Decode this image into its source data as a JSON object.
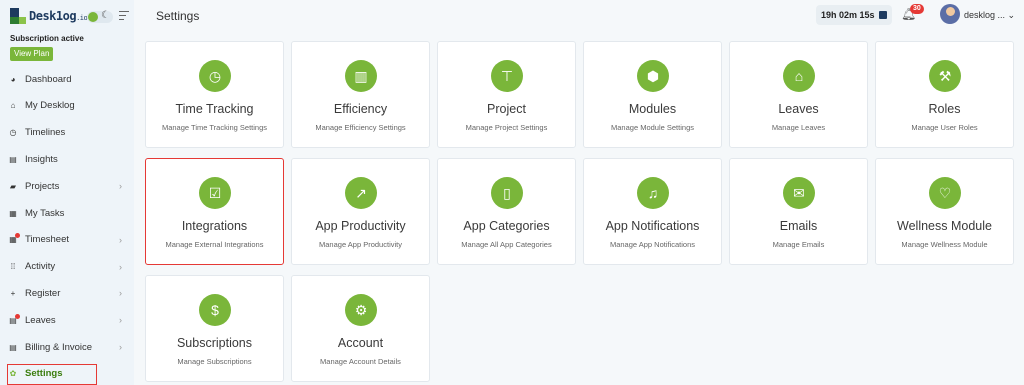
{
  "brand": {
    "name": "Desk1og",
    "suffix": ".io"
  },
  "subscription": {
    "status": "Subscription active",
    "view_plan": "View Plan"
  },
  "nav": [
    {
      "label": "Dashboard",
      "icon": "dashboard-icon",
      "glyph": "◕",
      "chevron": false,
      "dot": false
    },
    {
      "label": "My Desklog",
      "icon": "home-icon",
      "glyph": "⌂",
      "chevron": false,
      "dot": false
    },
    {
      "label": "Timelines",
      "icon": "clock-icon",
      "glyph": "◷",
      "chevron": false,
      "dot": false
    },
    {
      "label": "Insights",
      "icon": "book-icon",
      "glyph": "▤",
      "chevron": false,
      "dot": false
    },
    {
      "label": "Projects",
      "icon": "folder-icon",
      "glyph": "▰",
      "chevron": true,
      "dot": false
    },
    {
      "label": "My Tasks",
      "icon": "tasks-icon",
      "glyph": "▦",
      "chevron": false,
      "dot": false
    },
    {
      "label": "Timesheet",
      "icon": "calendar-icon",
      "glyph": "▦",
      "chevron": true,
      "dot": true
    },
    {
      "label": "Activity",
      "icon": "grid-icon",
      "glyph": "⁞⁞",
      "chevron": true,
      "dot": false
    },
    {
      "label": "Register",
      "icon": "plus-icon",
      "glyph": "+",
      "chevron": true,
      "dot": false
    },
    {
      "label": "Leaves",
      "icon": "leaves-icon",
      "glyph": "▤",
      "chevron": true,
      "dot": true
    },
    {
      "label": "Billing & Invoice",
      "icon": "billing-icon",
      "glyph": "▤",
      "chevron": true,
      "dot": false
    },
    {
      "label": "Settings",
      "icon": "settings-icon",
      "glyph": "✿",
      "chevron": false,
      "dot": false,
      "active": true
    }
  ],
  "header": {
    "title": "Settings",
    "timer": "19h 02m 15s",
    "notifications": "30",
    "user": "desklog ..."
  },
  "cards": [
    {
      "title": "Time Tracking",
      "desc": "Manage Time Tracking Settings",
      "icon": "clock-icon",
      "glyph": "◷"
    },
    {
      "title": "Efficiency",
      "desc": "Manage Efficiency Settings",
      "icon": "bar-chart-icon",
      "glyph": "▥"
    },
    {
      "title": "Project",
      "desc": "Manage Project Settings",
      "icon": "hierarchy-icon",
      "glyph": "⊤"
    },
    {
      "title": "Modules",
      "desc": "Manage Module Settings",
      "icon": "cubes-icon",
      "glyph": "⬢"
    },
    {
      "title": "Leaves",
      "desc": "Manage Leaves",
      "icon": "home-icon",
      "glyph": "⌂"
    },
    {
      "title": "Roles",
      "desc": "Manage User Roles",
      "icon": "wrench-icon",
      "glyph": "⚒"
    },
    {
      "title": "Integrations",
      "desc": "Manage External Integrations",
      "icon": "checkbox-icon",
      "glyph": "☑",
      "highlight": true
    },
    {
      "title": "App Productivity",
      "desc": "Manage App Productivity",
      "icon": "trend-chart-icon",
      "glyph": "↗"
    },
    {
      "title": "App Categories",
      "desc": "Manage All App Categories",
      "icon": "mobile-icon",
      "glyph": "▯"
    },
    {
      "title": "App Notifications",
      "desc": "Manage App Notifications",
      "icon": "bell-icon",
      "glyph": "♫"
    },
    {
      "title": "Emails",
      "desc": "Manage Emails",
      "icon": "envelope-icon",
      "glyph": "✉"
    },
    {
      "title": "Wellness Module",
      "desc": "Manage Wellness Module",
      "icon": "heart-icon",
      "glyph": "♡"
    },
    {
      "title": "Subscriptions",
      "desc": "Manage Subscriptions",
      "icon": "money-icon",
      "glyph": "$"
    },
    {
      "title": "Account",
      "desc": "Manage Account Details",
      "icon": "gears-icon",
      "glyph": "⚙"
    }
  ]
}
